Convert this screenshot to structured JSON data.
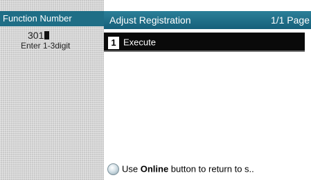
{
  "left": {
    "header": "Function Number",
    "value": "301",
    "hint": "Enter 1-3digit"
  },
  "screen": {
    "title": "Adjust Registration",
    "page": "1/1 Page"
  },
  "menu": {
    "items": [
      {
        "number": "1",
        "label": "Execute"
      }
    ]
  },
  "footer": {
    "pre": "Use ",
    "bold": "Online",
    "post": " button to return to s.."
  },
  "icons": {
    "online": "online-button-icon"
  }
}
